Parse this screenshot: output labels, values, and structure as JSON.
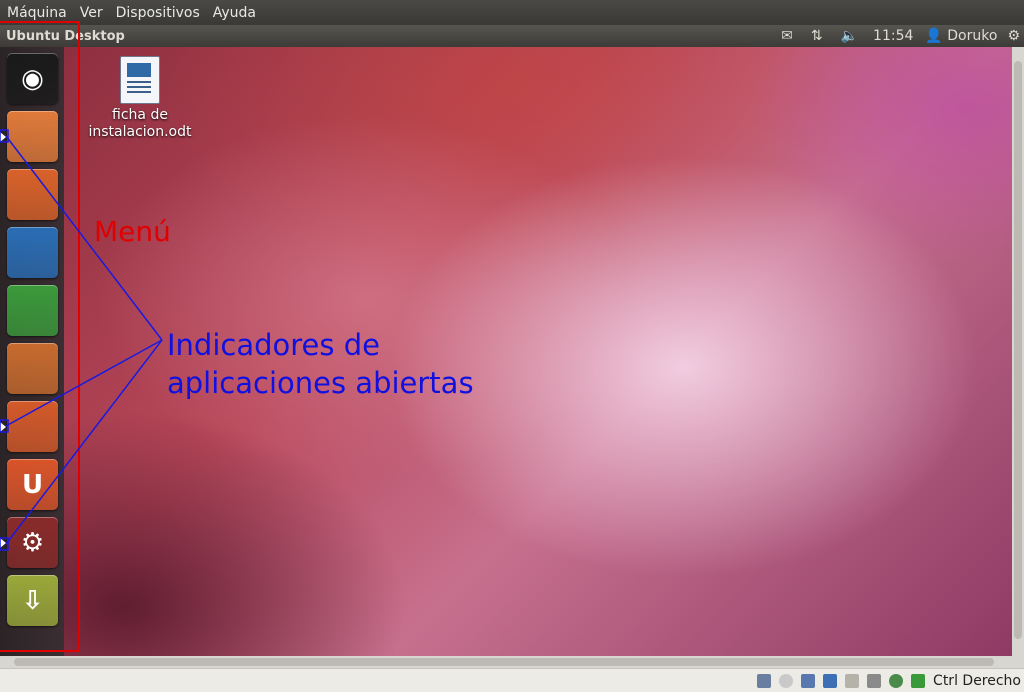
{
  "vbox_menu": [
    "Máquina",
    "Ver",
    "Dispositivos",
    "Ayuda"
  ],
  "panel": {
    "title": "Ubuntu Desktop",
    "indicators": [
      "envelope-icon",
      "network-icon",
      "volume-icon"
    ],
    "clock": "11:54",
    "user": "Doruko"
  },
  "launcher": [
    {
      "name": "dash-home",
      "color": "#1a1a1a",
      "running": false
    },
    {
      "name": "files",
      "color": "#e07a3a",
      "running": true
    },
    {
      "name": "firefox",
      "color": "#d9622a",
      "running": false
    },
    {
      "name": "libreoffice-writer",
      "color": "#2a6db5",
      "running": false
    },
    {
      "name": "libreoffice-calc",
      "color": "#3b9a3b",
      "running": false
    },
    {
      "name": "libreoffice-impress",
      "color": "#c76b2e",
      "running": false
    },
    {
      "name": "software-center",
      "color": "#d45a2a",
      "running": true
    },
    {
      "name": "ubuntu-one",
      "color": "#d9542a",
      "running": false
    },
    {
      "name": "system-settings",
      "color": "#8a2a2a",
      "running": true
    },
    {
      "name": "update-manager",
      "color": "#9aa83a",
      "running": false
    }
  ],
  "desktop_file": {
    "line1": "ficha de",
    "line2": "instalacion.odt"
  },
  "annotations": {
    "menu": "Menú",
    "indicators_line1": "Indicadores de",
    "indicators_line2": "aplicaciones abiertas"
  },
  "statusbar": {
    "host_key": "Ctrl Derecho"
  }
}
